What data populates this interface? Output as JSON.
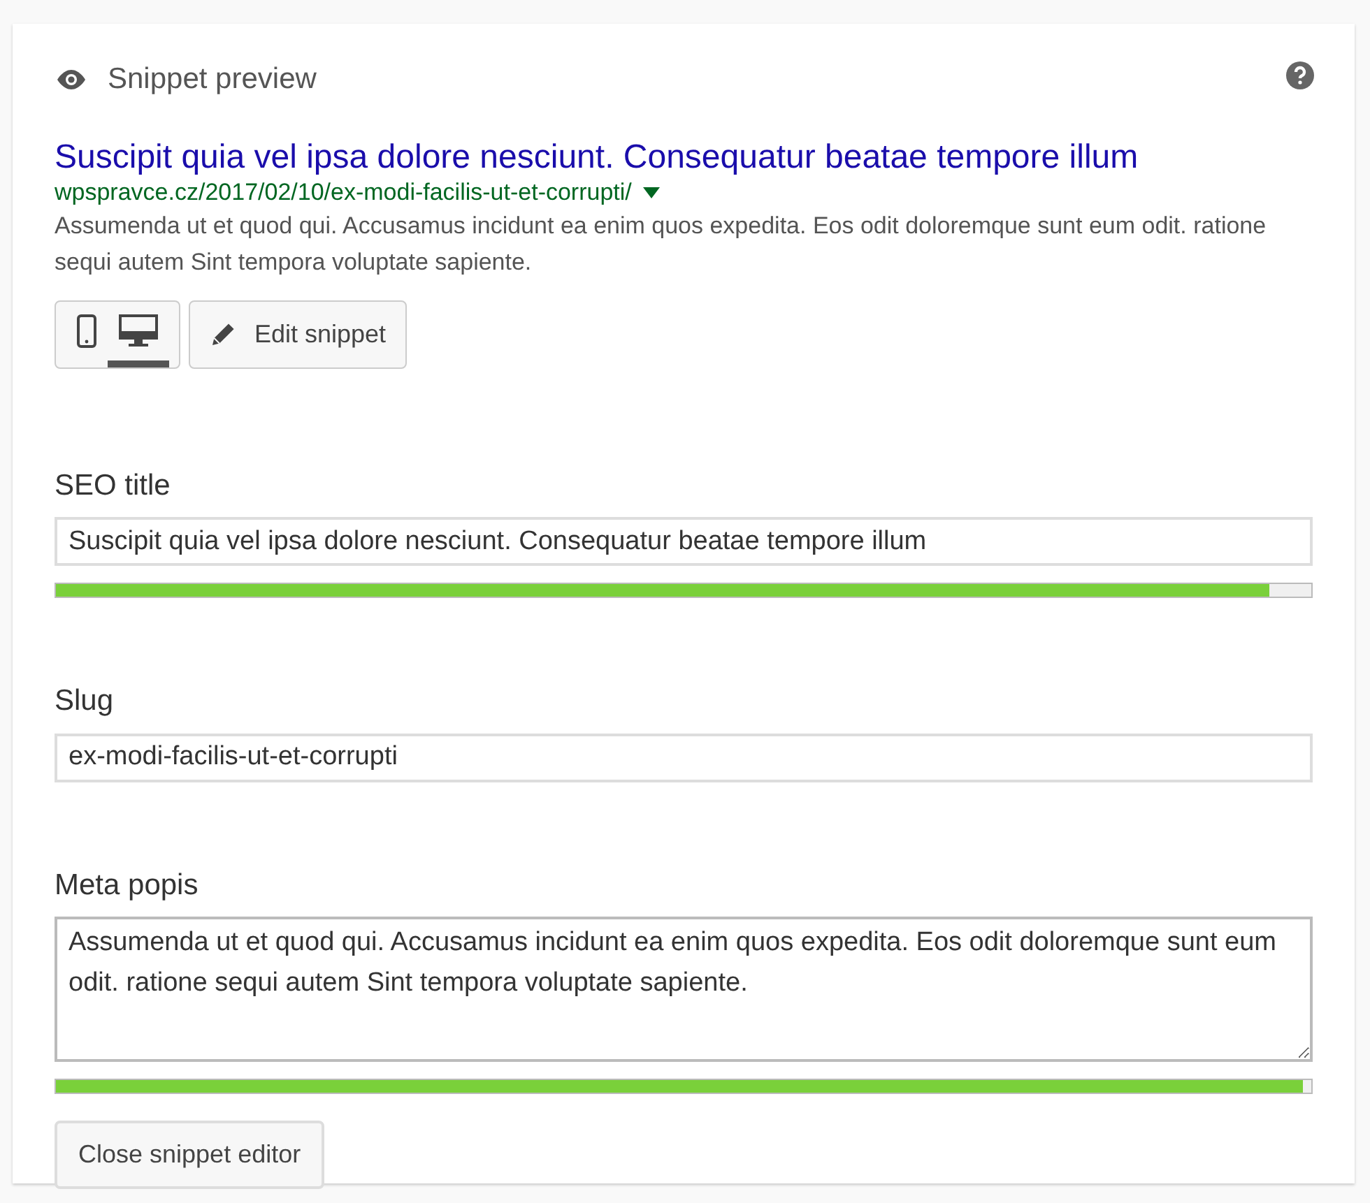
{
  "header": {
    "title": "Snippet preview"
  },
  "preview": {
    "title": "Suscipit quia vel ipsa dolore nesciunt. Consequatur beatae tempore illum",
    "url": "wpspravce.cz/2017/02/10/ex-modi-facilis-ut-et-corrupti/",
    "description": "Assumenda ut et quod qui. Accusamus incidunt ea enim quos expedita. Eos odit doloremque sunt eum odit. ratione sequi autem Sint tempora voluptate sapiente."
  },
  "devices": [
    {
      "kind": "mobile",
      "selected": false
    },
    {
      "kind": "desktop",
      "selected": true
    }
  ],
  "edit_button": "Edit snippet",
  "fields": [
    {
      "kind": "input",
      "label": "SEO title",
      "value": "Suscipit quia vel ipsa dolore nesciunt. Consequatur beatae tempore illum",
      "level": 0.967
    },
    {
      "kind": "input",
      "label": "Slug",
      "value": "ex-modi-facilis-ut-et-corrupti"
    },
    {
      "kind": "textarea",
      "label": "Meta popis",
      "value": "Assumenda ut et quod qui. Accusamus incidunt ea enim quos expedita. Eos odit doloremque sunt eum odit. ratione sequi autem Sint tempora voluptate sapiente.",
      "level": 0.993
    }
  ],
  "close_button": "Close snippet editor"
}
